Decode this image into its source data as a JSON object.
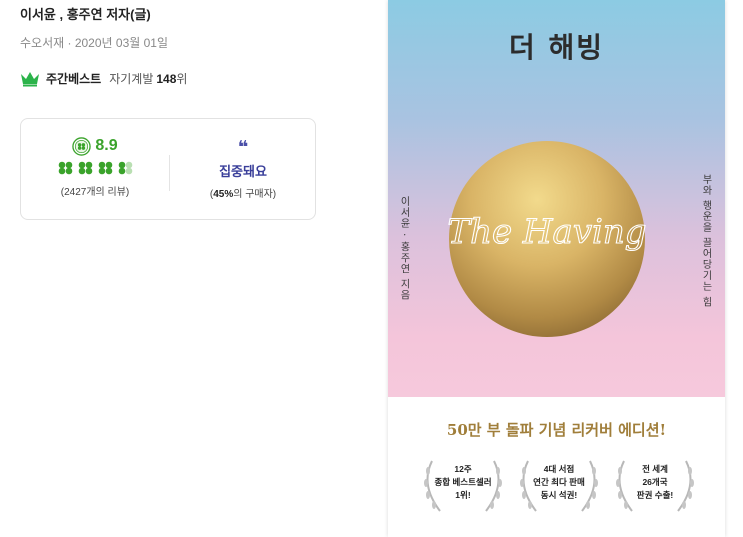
{
  "product": {
    "author_line": "이서윤 , 홍주연 저자(글)",
    "publisher_line": "수오서재 · 2020년 03월 01일"
  },
  "ranking": {
    "badge_label": "주간베스트",
    "category": "자기계발",
    "rank_number": "148",
    "rank_unit": "위"
  },
  "review": {
    "score": "8.9",
    "clover_rating": 4.5,
    "review_count_text": "(2427개의 리뷰)",
    "quote_mark": "❝",
    "emotion_label": "집중돼요",
    "buyer_percent": "45%",
    "buyer_suffix": "의 구매자)",
    "buyer_prefix": "("
  },
  "cover": {
    "title": "더 해빙",
    "script_title": "The Having",
    "author_vertical": "이서윤 · 홍주연 지음",
    "subtitle_vertical": "부와 행운을 끌어당기는 힘",
    "tagline": "50만 부 돌파 기념 리커버 에디션!",
    "awards": [
      {
        "line1": "12주",
        "line2": "종합 베스트셀러",
        "line3": "1위!"
      },
      {
        "line1": "4대 서점",
        "line2": "연간 최다 판매",
        "line3": "동시 석권!"
      },
      {
        "line1": "전 세계",
        "line2": "26개국",
        "line3": "판권 수출!"
      }
    ],
    "colors": {
      "top": "#8ccbe3",
      "bottom": "#f6c9dc",
      "gold": "#c9a24a"
    }
  },
  "colors": {
    "score_green": "#3aa32b",
    "emotion_blue": "#3a3f9a"
  }
}
